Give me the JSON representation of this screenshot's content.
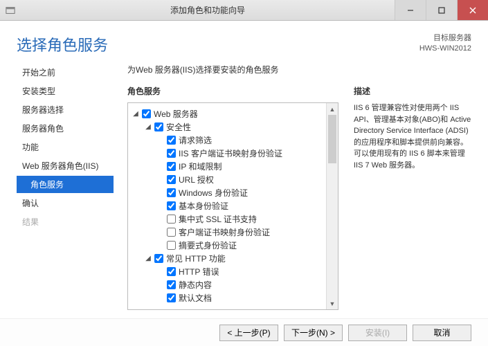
{
  "window": {
    "title": "添加角色和功能向导"
  },
  "header": {
    "title": "选择角色服务",
    "server_label": "目标服务器",
    "server_name": "HWS-WIN2012"
  },
  "nav": {
    "items": [
      {
        "label": "开始之前",
        "indent": false,
        "active": false
      },
      {
        "label": "安装类型",
        "indent": false,
        "active": false
      },
      {
        "label": "服务器选择",
        "indent": false,
        "active": false
      },
      {
        "label": "服务器角色",
        "indent": false,
        "active": false
      },
      {
        "label": "功能",
        "indent": false,
        "active": false
      },
      {
        "label": "Web 服务器角色(IIS)",
        "indent": false,
        "active": false
      },
      {
        "label": "角色服务",
        "indent": true,
        "active": true
      },
      {
        "label": "确认",
        "indent": false,
        "active": false
      },
      {
        "label": "结果",
        "indent": false,
        "active": false,
        "disabled": true
      }
    ]
  },
  "main": {
    "instruction": "为Web 服务器(IIS)选择要安装的角色服务",
    "roles_heading": "角色服务",
    "desc_heading": "描述",
    "description": "IIS 6 管理兼容性对使用两个 IIS API、管理基本对象(ABO)和 Active Directory Service Interface (ADSI) 的应用程序和脚本提供前向兼容。可以使用现有的 IIS 6 脚本来管理 IIS 7 Web 服务器。"
  },
  "tree": [
    {
      "depth": 0,
      "caret": "open",
      "checked": true,
      "label": "Web 服务器"
    },
    {
      "depth": 1,
      "caret": "open",
      "checked": true,
      "label": "安全性"
    },
    {
      "depth": 2,
      "caret": "none",
      "checked": true,
      "label": "请求筛选"
    },
    {
      "depth": 2,
      "caret": "none",
      "checked": true,
      "label": "IIS 客户端证书映射身份验证"
    },
    {
      "depth": 2,
      "caret": "none",
      "checked": true,
      "label": "IP 和域限制"
    },
    {
      "depth": 2,
      "caret": "none",
      "checked": true,
      "label": "URL 授权"
    },
    {
      "depth": 2,
      "caret": "none",
      "checked": true,
      "label": "Windows 身份验证"
    },
    {
      "depth": 2,
      "caret": "none",
      "checked": true,
      "label": "基本身份验证"
    },
    {
      "depth": 2,
      "caret": "none",
      "checked": false,
      "label": "集中式 SSL 证书支持"
    },
    {
      "depth": 2,
      "caret": "none",
      "checked": false,
      "label": "客户端证书映射身份验证"
    },
    {
      "depth": 2,
      "caret": "none",
      "checked": false,
      "label": "摘要式身份验证"
    },
    {
      "depth": 1,
      "caret": "open",
      "checked": true,
      "label": "常见 HTTP 功能"
    },
    {
      "depth": 2,
      "caret": "none",
      "checked": true,
      "label": "HTTP 错误"
    },
    {
      "depth": 2,
      "caret": "none",
      "checked": true,
      "label": "静态内容"
    },
    {
      "depth": 2,
      "caret": "none",
      "checked": true,
      "label": "默认文档"
    }
  ],
  "footer": {
    "prev": "< 上一步(P)",
    "next": "下一步(N) >",
    "install": "安装(I)",
    "cancel": "取消"
  }
}
